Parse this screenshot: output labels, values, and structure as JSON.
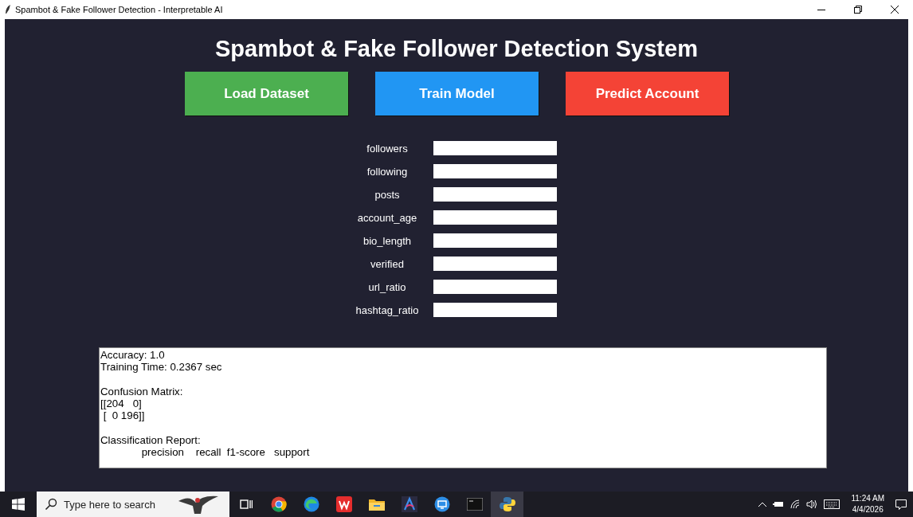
{
  "window": {
    "title": "Spambot & Fake Follower Detection - Interpretable AI"
  },
  "heading": "Spambot & Fake Follower Detection System",
  "buttons": [
    {
      "label": "Load Dataset",
      "color": "#4caf50"
    },
    {
      "label": "Train Model",
      "color": "#2196f3"
    },
    {
      "label": "Predict Account",
      "color": "#f44336"
    }
  ],
  "fields": [
    {
      "label": "followers"
    },
    {
      "label": "following"
    },
    {
      "label": "posts"
    },
    {
      "label": "account_age"
    },
    {
      "label": "bio_length"
    },
    {
      "label": "verified"
    },
    {
      "label": "url_ratio"
    },
    {
      "label": "hashtag_ratio"
    }
  ],
  "output": {
    "text": "Accuracy: 1.0\nTraining Time: 0.2367 sec\n\nConfusion Matrix:\n[[204   0]\n [  0 196]]\n\nClassification Report:\n              precision    recall  f1-score   support"
  },
  "taskbar": {
    "search_placeholder": "Type here to search",
    "apps": [
      {
        "kind": "taskview",
        "selected": false
      },
      {
        "kind": "chrome",
        "selected": false
      },
      {
        "kind": "edge",
        "selected": false
      },
      {
        "kind": "wps",
        "selected": false
      },
      {
        "kind": "folder",
        "selected": false
      },
      {
        "kind": "arch",
        "selected": false
      },
      {
        "kind": "remote",
        "selected": false
      },
      {
        "kind": "terminal",
        "selected": false
      },
      {
        "kind": "python",
        "selected": true
      }
    ],
    "time": "11:24 AM",
    "date": "4/4/2026"
  }
}
